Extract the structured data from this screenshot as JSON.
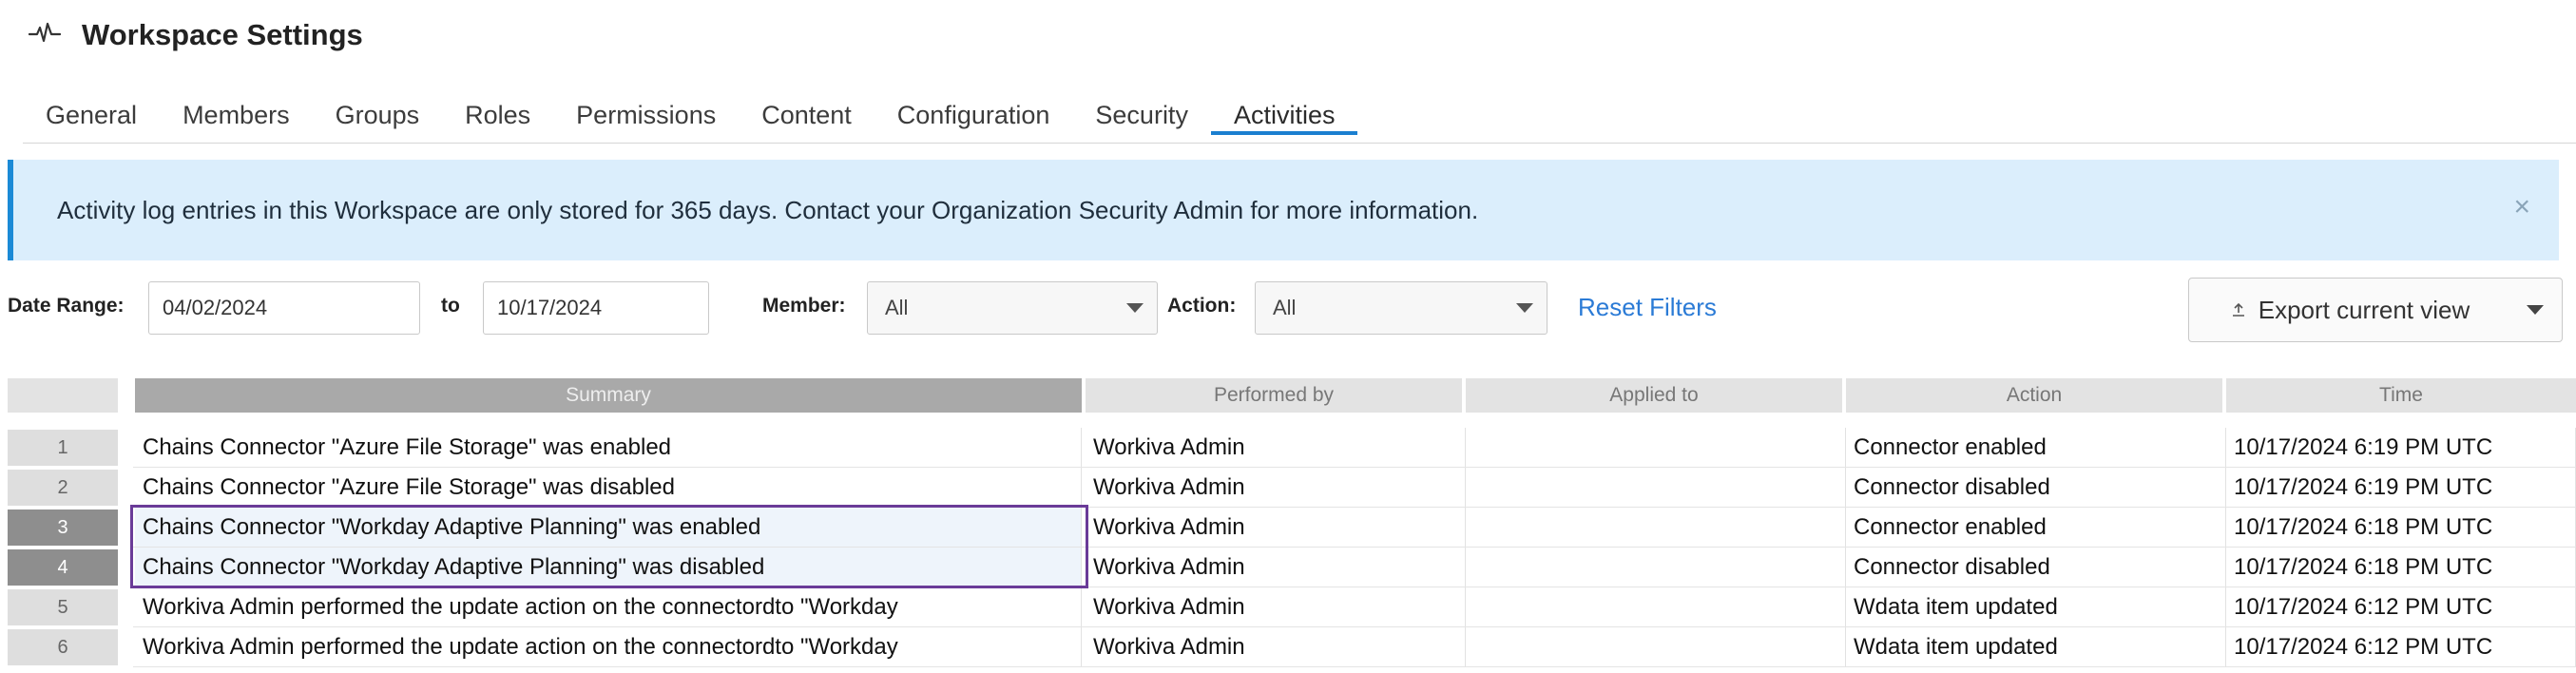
{
  "header": {
    "title": "Workspace Settings",
    "icon": "activity-pulse-icon"
  },
  "tabs": [
    {
      "label": "General"
    },
    {
      "label": "Members"
    },
    {
      "label": "Groups"
    },
    {
      "label": "Roles"
    },
    {
      "label": "Permissions"
    },
    {
      "label": "Content"
    },
    {
      "label": "Configuration"
    },
    {
      "label": "Security"
    },
    {
      "label": "Activities",
      "active": true
    }
  ],
  "banner": {
    "text": "Activity log entries in this Workspace are only stored for 365 days. Contact your Organization Security Admin for more information.",
    "close": "×"
  },
  "filters": {
    "date_range_label": "Date Range:",
    "date_from": "04/02/2024",
    "to_label": "to",
    "date_to": "10/17/2024",
    "member_label": "Member:",
    "member_value": "All",
    "action_label": "Action:",
    "action_value": "All",
    "reset_label": "Reset Filters",
    "export_label": "Export current view"
  },
  "table": {
    "columns": [
      "Summary",
      "Performed by",
      "Applied to",
      "Action",
      "Time"
    ],
    "rows": [
      {
        "num": "1",
        "summary": "Chains Connector \"Azure File Storage\" was enabled",
        "performed_by": "Workiva Admin",
        "applied_to": "",
        "action": "Connector enabled",
        "time": "10/17/2024 6:19 PM UTC"
      },
      {
        "num": "2",
        "summary": "Chains Connector \"Azure File Storage\" was disabled",
        "performed_by": "Workiva Admin",
        "applied_to": "",
        "action": "Connector disabled",
        "time": "10/17/2024 6:19 PM UTC"
      },
      {
        "num": "3",
        "summary": "Chains Connector \"Workday Adaptive Planning\" was enabled",
        "performed_by": "Workiva Admin",
        "applied_to": "",
        "action": "Connector enabled",
        "time": "10/17/2024 6:18 PM UTC",
        "selected": true
      },
      {
        "num": "4",
        "summary": "Chains Connector \"Workday Adaptive Planning\" was disabled",
        "performed_by": "Workiva Admin",
        "applied_to": "",
        "action": "Connector disabled",
        "time": "10/17/2024 6:18 PM UTC",
        "selected": true
      },
      {
        "num": "5",
        "summary": "Workiva Admin performed the update action on the connectordto \"Workday",
        "performed_by": "Workiva Admin",
        "applied_to": "",
        "action": "Wdata item updated",
        "time": "10/17/2024 6:12 PM UTC"
      },
      {
        "num": "6",
        "summary": "Workiva Admin performed the update action on the connectordto \"Workday",
        "performed_by": "Workiva Admin",
        "applied_to": "",
        "action": "Wdata item updated",
        "time": "10/17/2024 6:12 PM UTC"
      }
    ]
  },
  "colors": {
    "accent": "#1b7fd0",
    "banner_bg": "#dbeefc",
    "link": "#2b7bd6",
    "highlight_border": "#6a3b98"
  }
}
